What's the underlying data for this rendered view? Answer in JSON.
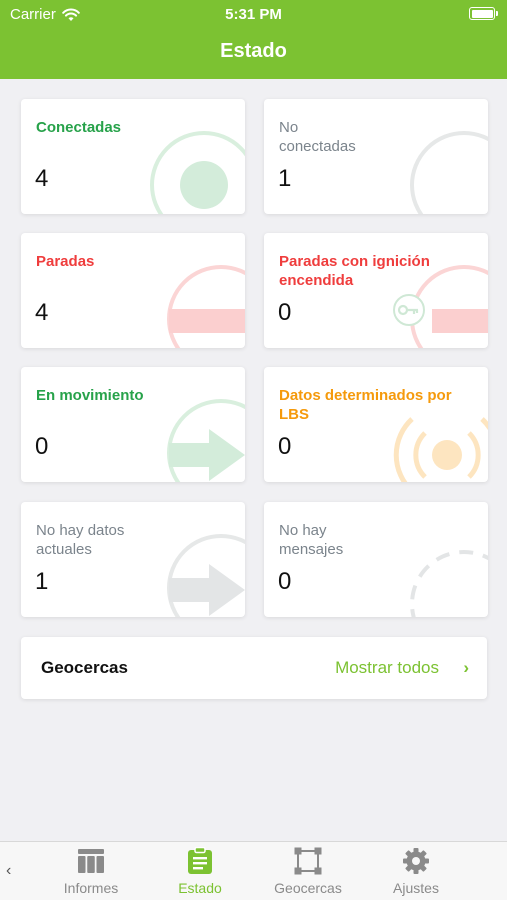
{
  "status_bar": {
    "carrier": "Carrier",
    "time": "5:31 PM"
  },
  "header": {
    "title": "Estado"
  },
  "colors": {
    "brand": "#7cc232",
    "connected": "#27a24a",
    "stopped": "#ef3d3d",
    "lbs": "#f59a0c",
    "muted": "#7b848c"
  },
  "cards": [
    {
      "label": "Conectadas",
      "value": "4"
    },
    {
      "label": "No conectadas",
      "value": "1"
    },
    {
      "label": "Paradas",
      "value": "4"
    },
    {
      "label": "Paradas con ignición encendida",
      "value": "0"
    },
    {
      "label": "En movimiento",
      "value": "0"
    },
    {
      "label": "Datos determinados por LBS",
      "value": "0"
    },
    {
      "label": "No hay datos actuales",
      "value": "1"
    },
    {
      "label": "No hay mensajes",
      "value": "0"
    }
  ],
  "geofences": {
    "title": "Geocercas",
    "link": "Mostrar todos"
  },
  "tabs": [
    {
      "label": "Informes",
      "icon": "table-icon"
    },
    {
      "label": "Estado",
      "icon": "clipboard-icon"
    },
    {
      "label": "Geocercas",
      "icon": "geofence-icon"
    },
    {
      "label": "Ajustes",
      "icon": "gear-icon"
    }
  ],
  "active_tab": "Estado"
}
